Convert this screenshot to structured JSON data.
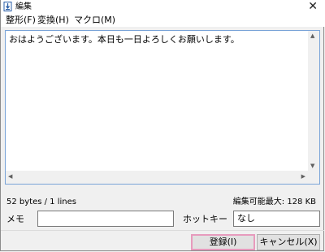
{
  "window": {
    "title": "編集",
    "close_glyph": "✕",
    "app_icon": "notepad-download-icon"
  },
  "menu": {
    "items": [
      {
        "label": "整形(F)"
      },
      {
        "label": "変換(H)"
      },
      {
        "label": "マクロ(M)"
      }
    ]
  },
  "editor": {
    "content": "おはようございます。本日も一日よろしくお願いします。"
  },
  "status": {
    "size_info": "52 bytes / 1 lines",
    "max_info": "編集可能最大: 128 KB"
  },
  "fields": {
    "memo_label": "メモ",
    "memo_value": "",
    "hotkey_label": "ホットキー",
    "hotkey_value": "なし"
  },
  "buttons": {
    "register": "登録(I)",
    "cancel": "キャンセル(X)"
  },
  "colors": {
    "editor_border": "#7aa4d8",
    "default_button_border": "#e79bbd"
  }
}
